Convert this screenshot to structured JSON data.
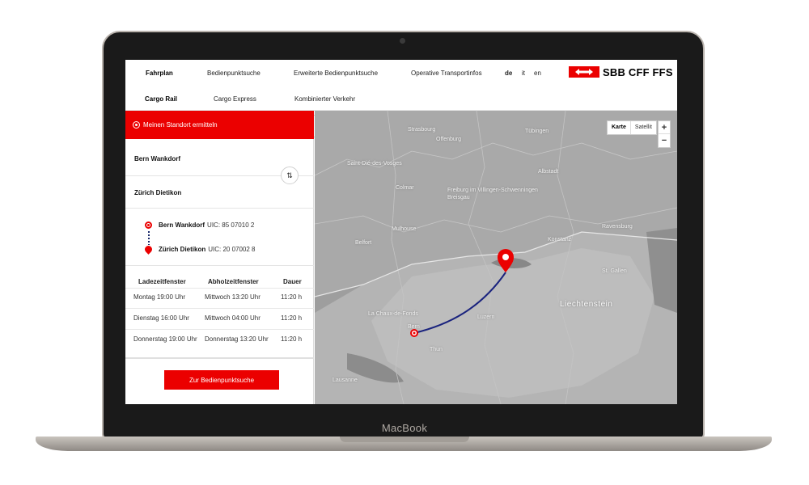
{
  "device": {
    "brand": "MacBook"
  },
  "nav": {
    "row1": [
      "Fahrplan",
      "Bedienpunktsuche",
      "Erweiterte Bedienpunktsuche",
      "Operative Transportinfos"
    ],
    "row2": [
      "Cargo Rail",
      "Cargo Express",
      "Kombinierter Verkehr"
    ],
    "languages": [
      "de",
      "it",
      "en"
    ],
    "logo_text": "SBB CFF FFS"
  },
  "sidebar": {
    "locate_label": "Meinen Standort ermitteln",
    "from": "Bern Wankdorf",
    "to": "Zürich Dietikon",
    "route": [
      {
        "station": "Bern Wankdorf",
        "uic": "UIC: 85 07010 2"
      },
      {
        "station": "Zürich Dietikon",
        "uic": "UIC: 20 07002 8"
      }
    ],
    "table": {
      "headers": [
        "Ladezeitfenster",
        "Abholzeitfenster",
        "Dauer"
      ],
      "rows": [
        [
          "Montag 19:00 Uhr",
          "Mittwoch 13:20 Uhr",
          "11:20 h"
        ],
        [
          "Dienstag 16:00 Uhr",
          "Mittwoch 04:00 Uhr",
          "11:20 h"
        ],
        [
          "Donnerstag 19:00 Uhr",
          "Donnerstag 13:20 Uhr",
          "11:20 h"
        ]
      ]
    },
    "cta_label": "Zur Bedienpunktsuche"
  },
  "map": {
    "type_options": [
      "Karte",
      "Satellit"
    ],
    "zoom_in": "+",
    "zoom_out": "−",
    "labels": {
      "strasbourg": "Strasbourg",
      "offenburg": "Offenburg",
      "tubingen": "Tübingen",
      "saint_die": "Saint-Dié-des-Vosges",
      "freiburg": "Freiburg im Villingen-Schwenningen",
      "breisgau": "Breisgau",
      "albstadt": "Albstadt",
      "colmar": "Colmar",
      "mulhouse": "Mulhouse",
      "belfort": "Belfort",
      "konstanz": "Konstanz",
      "ravensburg": "Ravensburg",
      "liechtenstein": "Liechtenstein",
      "bern": "Bern",
      "thun": "Thun",
      "luzern": "Luzern",
      "lausanne": "Lausanne",
      "chaux": "La Chaux-de-Fonds",
      "stgallen": "St. Gallen"
    },
    "accent": "#eb0000",
    "route_color": "#1a237e"
  }
}
